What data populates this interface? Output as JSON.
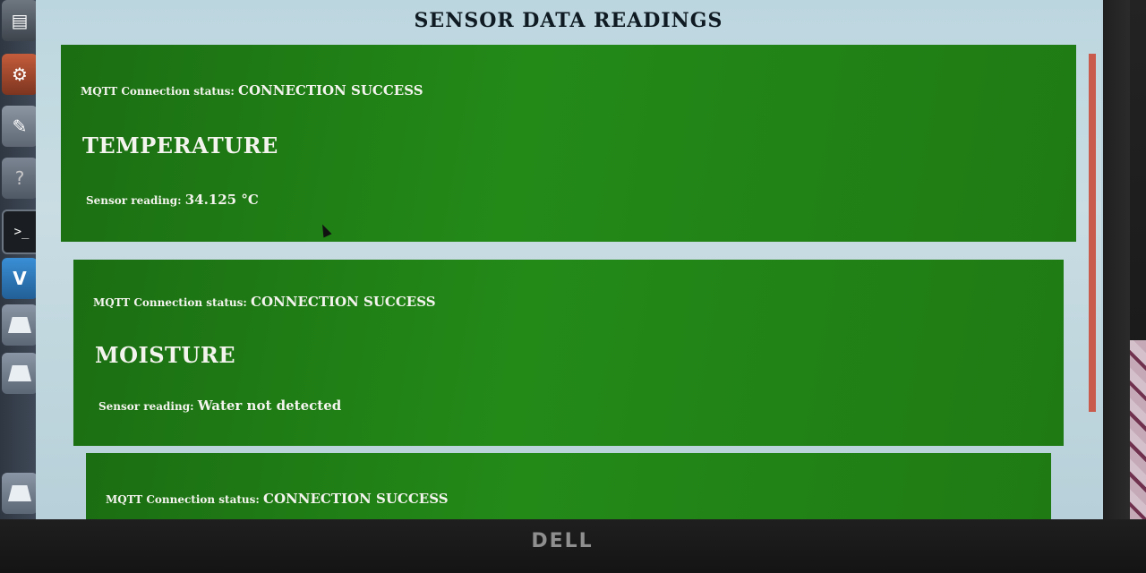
{
  "page": {
    "title": "SENSOR DATA READINGS"
  },
  "cards": [
    {
      "status_label": "MQTT Connection status:",
      "status_value": "CONNECTION SUCCESS",
      "heading": "TEMPERATURE",
      "reading_label": "Sensor reading:",
      "reading_value": "34.125 °C"
    },
    {
      "status_label": "MQTT Connection status:",
      "status_value": "CONNECTION SUCCESS",
      "heading": "MOISTURE",
      "reading_label": "Sensor reading:",
      "reading_value": "Water not detected"
    },
    {
      "status_label": "MQTT Connection status:",
      "status_value": "CONNECTION SUCCESS"
    }
  ],
  "launcher": {
    "icons": [
      "files-icon",
      "settings-icon",
      "text-editor-icon",
      "help-icon",
      "terminal-icon",
      "vscode-icon",
      "drive-icon",
      "drive-icon",
      "trash-icon"
    ],
    "terminal_glyph": ">_",
    "vscode_glyph": "V",
    "help_glyph": "?"
  },
  "monitor": {
    "brand": "DELL"
  },
  "colors": {
    "card_green": "#238a18",
    "page_bg": "#c9dde3",
    "title_text": "#0f1a22"
  }
}
